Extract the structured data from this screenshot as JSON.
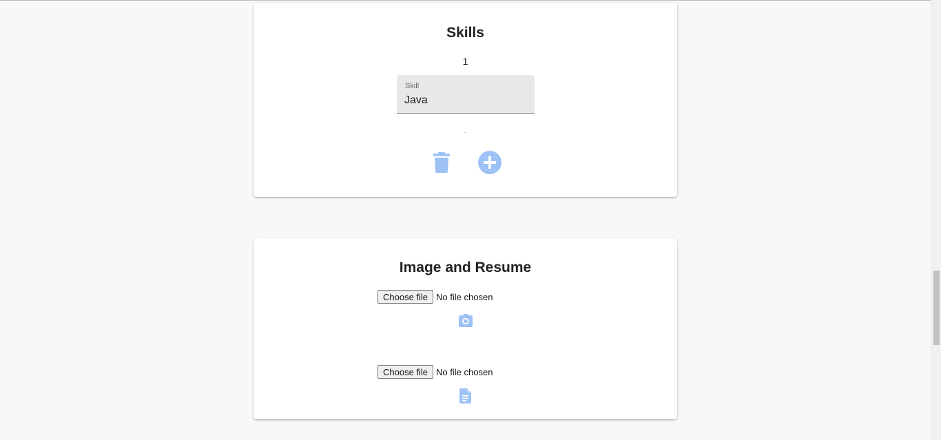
{
  "skills_section": {
    "title": "Skills",
    "index": "1",
    "skill_field": {
      "label": "Skill",
      "value": "Java"
    },
    "delete_icon": "trash-icon",
    "add_icon": "plus-circle-icon"
  },
  "uploads_section": {
    "title": "Image and Resume",
    "image_upload": {
      "button_label": "Choose file",
      "status": "No file chosen",
      "icon": "camera-icon"
    },
    "resume_upload": {
      "button_label": "Choose file",
      "status": "No file chosen",
      "icon": "document-icon"
    }
  },
  "colors": {
    "accent_icon": "#9ec2f5",
    "page_bg": "#f8f8f8",
    "field_bg": "#e8e8e8"
  }
}
